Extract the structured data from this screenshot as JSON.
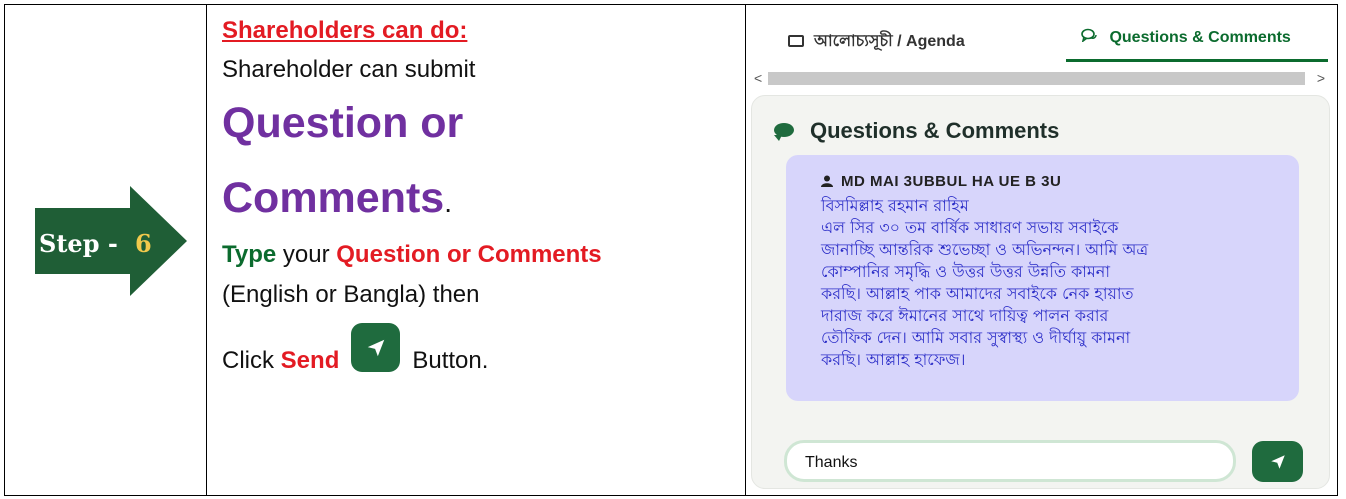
{
  "step": {
    "label": "Step - ",
    "number": "6"
  },
  "instructions": {
    "heading": "Shareholders can do:",
    "line1": "Shareholder can submit",
    "big1": "Question or",
    "big2": "Comments",
    "big2_suffix": ".",
    "type_word": "Type",
    "type_mid": " your ",
    "type_target": "Question or Comments",
    "line_lang": "(English or Bangla) then",
    "click_word": "Click ",
    "send_word": "Send",
    "button_word": "Button."
  },
  "panel": {
    "tabs": [
      {
        "label_bn": "আলোচ্যসূচী",
        "label_en": " / Agenda",
        "icon": "list-icon"
      },
      {
        "label": "Questions & Comments",
        "icon": "chat-icon"
      }
    ],
    "card_title": "Questions & Comments",
    "message": {
      "author": "MD MAI  3UBBUL HA  UE B  3U",
      "lines": [
        "বিসমিল্লাহ রহমান রাহিম",
        "এল সির ৩০ তম বার্ষিক সাধারণ সভায় সবাইকে",
        "জানাচ্ছি আন্তরিক শুভেচ্ছা ও অভিনন্দন। আমি অত্র",
        "কোম্পানির সমৃদ্ধি ও উত্তর উত্তর উন্নতি কামনা",
        "করছি। আল্লাহ পাক আমাদের সবাইকে নেক হায়াত",
        "দারাজ করে ঈমানের সাথে দায়িত্ব পালন করার",
        "তৌফিক দেন। আমি সবার সুস্বাস্থ্য ও দীর্ঘায়ু কামনা",
        "করছি। আল্লাহ হাফেজ।"
      ]
    },
    "input_value": "Thanks"
  },
  "colors": {
    "brand_green": "#1f6b3e",
    "accent_red": "#e31b23",
    "purple": "#7030a0",
    "message_bg": "#d7d5fb"
  }
}
